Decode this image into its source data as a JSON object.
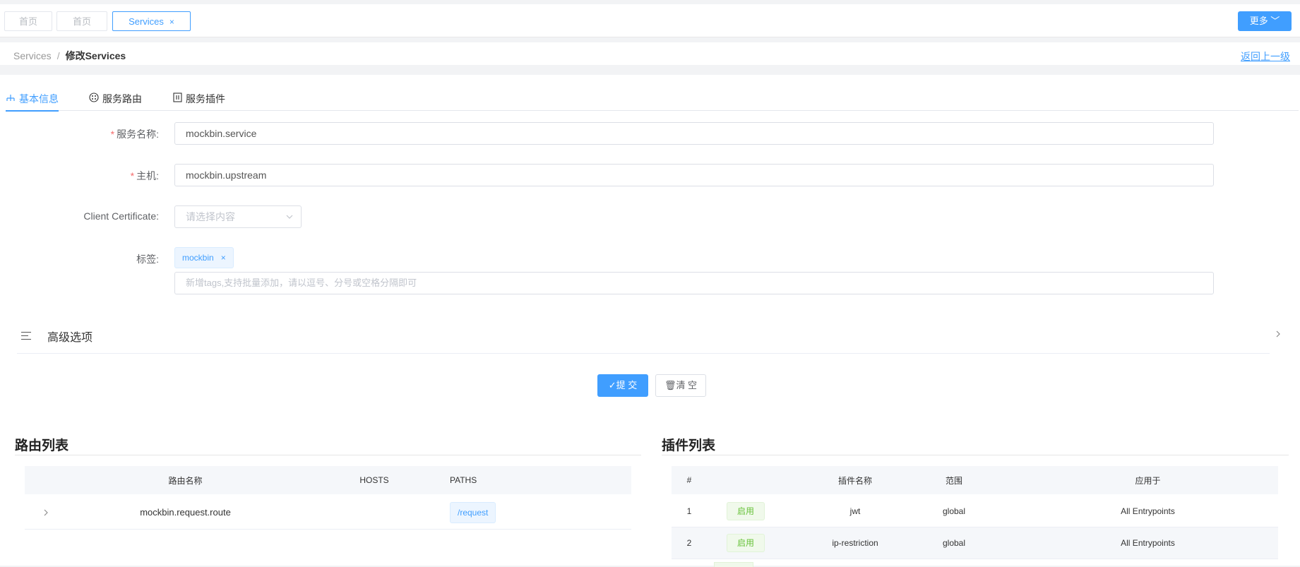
{
  "top_tabs": {
    "items": [
      {
        "label": "首页"
      },
      {
        "label": "首页"
      },
      {
        "label": "Services",
        "close": "×"
      }
    ],
    "more_label": "更多 ﹀"
  },
  "breadcrumb": {
    "root": "Services",
    "separator": "/",
    "current": "修改Services",
    "back_label": "返回上一级"
  },
  "tabs": [
    {
      "label": "基本信息",
      "icon": "sitemap-icon"
    },
    {
      "label": "服务路由",
      "icon": "route-icon"
    },
    {
      "label": "服务插件",
      "icon": "plugin-icon"
    }
  ],
  "form": {
    "service_name": {
      "label": "服务名称:",
      "value": "mockbin.service"
    },
    "host": {
      "label": "主机:",
      "value": "mockbin.upstream"
    },
    "client_cert": {
      "label": "Client Certificate:",
      "placeholder": "请选择内容"
    },
    "tags": {
      "label": "标签:",
      "items": [
        "mockbin"
      ],
      "placeholder": "新增tags,支持批量添加，请以逗号、分号或空格分隔即可"
    },
    "advanced_label": "高级选项",
    "submit_label": "✓提 交",
    "clear_label": "🗑清 空"
  },
  "routes": {
    "title": "路由列表",
    "columns": [
      "路由名称",
      "HOSTS",
      "PATHS"
    ],
    "rows": [
      {
        "name": "mockbin.request.route",
        "hosts": "",
        "paths": "/request"
      }
    ]
  },
  "plugins": {
    "title": "插件列表",
    "columns": [
      "#",
      "",
      "插件名称",
      "范围",
      "应用于"
    ],
    "rows": [
      {
        "index": "1",
        "status": "启用",
        "name": "jwt",
        "scope": "global",
        "applies_to": "All Entrypoints"
      },
      {
        "index": "2",
        "status": "启用",
        "name": "ip-restriction",
        "scope": "global",
        "applies_to": "All Entrypoints"
      }
    ]
  },
  "colors": {
    "primary": "#409eff",
    "success": "#67c23a",
    "danger": "#f56c6c"
  }
}
